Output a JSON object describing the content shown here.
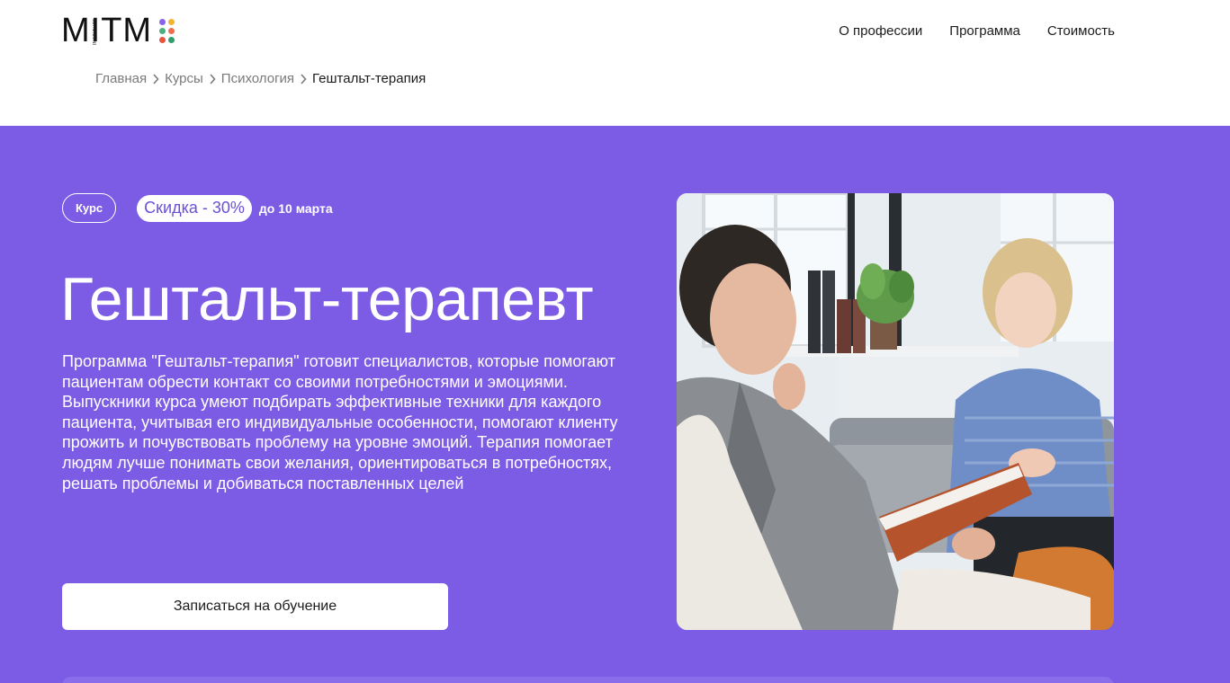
{
  "header": {
    "logo": {
      "text": "MITM",
      "sub": "INSTITUTE",
      "dot_colors": [
        "#8a63e8",
        "#f2b233",
        "#4caf7d",
        "#ee6f4d",
        "#e9543e",
        "#2f9e6b"
      ]
    },
    "nav": [
      {
        "label": "О профессии"
      },
      {
        "label": "Программа"
      },
      {
        "label": "Стоимость"
      }
    ],
    "breadcrumb": [
      {
        "label": "Главная"
      },
      {
        "label": "Курсы"
      },
      {
        "label": "Психология"
      },
      {
        "label": "Гештальт-терапия"
      }
    ]
  },
  "hero": {
    "background_color": "#7c5ce4",
    "tag_course": "Курс",
    "discount": "Скидка - 30%",
    "discount_until": "до 10 марта",
    "title": "Гештальт-терапевт",
    "description": "Программа \"Гештальт-терапия\" готовит специалистов, которые помогают пациентам обрести контакт со своими потребностями и эмоциями. Выпускники курса умеют подбирать эффективные техники для каждого пациента, учитывая его индивидуальные особенности, помогают клиенту прожить и почувствовать проблему на уровне эмоций. Терапия помогает людям лучше понимать свои желания, ориентироваться в потребностях, решать проблемы и добиваться поставленных целей",
    "cta_label": "Записаться на обучение",
    "photo": "therapy-session-photo"
  }
}
